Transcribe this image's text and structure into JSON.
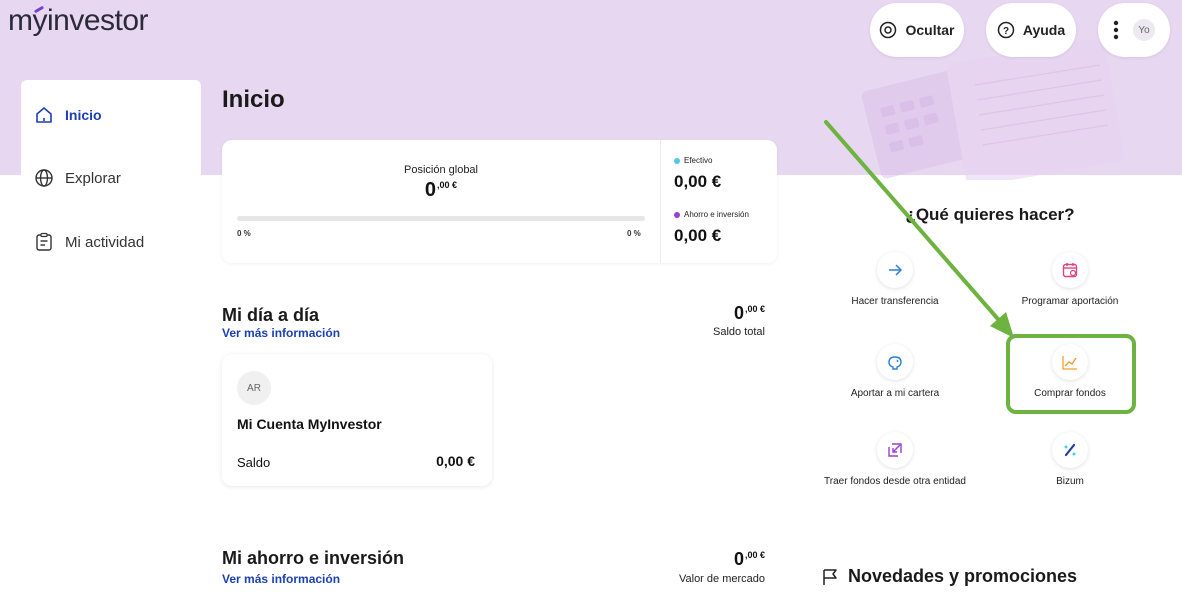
{
  "header": {
    "logo": "myinvestor",
    "logo_parts": [
      "m",
      "y",
      "investor"
    ],
    "hide_label": "Ocultar",
    "help_label": "Ayuda",
    "user_initials": "Yo"
  },
  "sidebar": {
    "items": [
      {
        "label": "Inicio",
        "icon": "home-icon",
        "active": true
      },
      {
        "label": "Explorar",
        "icon": "globe-icon",
        "active": false
      },
      {
        "label": "Mi actividad",
        "icon": "activity-icon",
        "active": false
      }
    ]
  },
  "main": {
    "title": "Inicio",
    "summary": {
      "global_label": "Posición global",
      "global_value": "0",
      "global_decimals": ",00 €",
      "progress_left": "0 %",
      "progress_right": "0 %",
      "progress_fraction": 0,
      "cash_label": "Efectivo",
      "cash_value": "0,00 €",
      "savings_label": "Ahorro e inversión",
      "savings_value": "0,00 €"
    },
    "day": {
      "title": "Mi día a día",
      "more_link": "Ver más información",
      "total_value": "0",
      "total_decimals": ",00 €",
      "total_caption": "Saldo total"
    },
    "account_card": {
      "initials": "AR",
      "name": "Mi Cuenta MyInvestor",
      "balance_label": "Saldo",
      "balance_value": "0,00 €"
    },
    "savings": {
      "title": "Mi ahorro e inversión",
      "more_link": "Ver más información",
      "market_value": "0",
      "market_decimals": ",00 €",
      "market_caption": "Valor de mercado"
    }
  },
  "actions": {
    "title": "¿Qué quieres hacer?",
    "items": [
      {
        "label": "Hacer transferencia",
        "icon": "arrow-right-icon"
      },
      {
        "label": "Programar aportación",
        "icon": "calendar-icon"
      },
      {
        "label": "Aportar a mi cartera",
        "icon": "piggy-bank-icon"
      },
      {
        "label": "Comprar fondos",
        "icon": "chart-line-icon"
      },
      {
        "label": "Traer fondos desde otra entidad",
        "icon": "transfer-in-icon"
      },
      {
        "label": "Bizum",
        "icon": "bizum-icon"
      }
    ]
  },
  "news": {
    "title": "Novedades y promociones"
  },
  "colors": {
    "hero_bg": "#e8d7f1",
    "brand_blue": "#1c3fb3",
    "cash_dot": "#4ec9e8",
    "savings_dot": "#9b3fd3",
    "highlight_green": "#6cb33f",
    "arrow_green": "#6cb33f",
    "icon_blue": "#2d7fd9",
    "icon_pink": "#e0457b",
    "icon_orange": "#f0a030",
    "icon_purple": "#9b3fd3",
    "icon_navy": "#1c3f9b"
  }
}
